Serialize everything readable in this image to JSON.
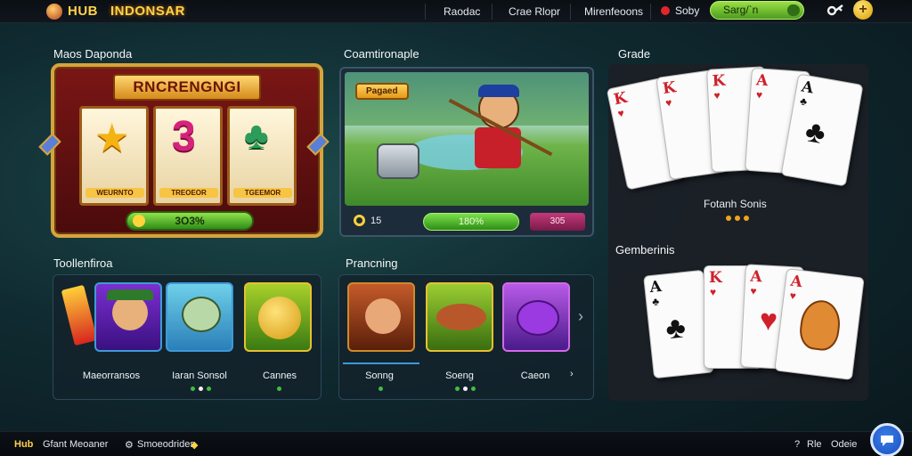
{
  "header": {
    "logo_hub": "HUB",
    "logo_name": "INDONSAR",
    "nav": [
      "Raodac",
      "Crae Rlopr",
      "Mirenfeoons"
    ],
    "ruby_label": "Soby",
    "pill_label": "Sarg/`n",
    "key_icon": "key-icon",
    "coin_icon": "coin-plus-icon",
    "coin_symbol": "+"
  },
  "slot_panel": {
    "title": "Maos Daponda",
    "banner": "RNCRENGNGI",
    "reels": [
      "WEURNTO",
      "TREOEOR",
      "TGEEMOR"
    ],
    "reel_symbols": [
      "★",
      "3",
      "♣"
    ],
    "button": "3O3%"
  },
  "adventure_panel": {
    "title": "Coamtironaple",
    "tag": "Pagaed",
    "left_value": "15",
    "bar_label": "180%",
    "right_label": "305"
  },
  "cards_panel_top": {
    "title": "Grade",
    "label": "Fotanh Sonis",
    "cards": [
      {
        "rank": "K",
        "suit": "♥",
        "color": "red"
      },
      {
        "rank": "K",
        "suit": "♥",
        "color": "red"
      },
      {
        "rank": "K",
        "suit": "♥",
        "color": "red"
      },
      {
        "rank": "A",
        "suit": "♥",
        "color": "red"
      },
      {
        "rank": "A",
        "suit": "♣",
        "color": "blk"
      }
    ]
  },
  "cards_panel_bottom": {
    "title": "Gemberinis",
    "cards": [
      {
        "rank": "A",
        "suit": "♣",
        "color": "blk"
      },
      {
        "rank": "K",
        "suit": "♥",
        "color": "red"
      },
      {
        "rank": "A",
        "suit": "♥",
        "color": "red"
      },
      {
        "rank": "A",
        "suit": "♥",
        "color": "red"
      }
    ]
  },
  "tournaments_panel": {
    "title": "Toollenfiroa",
    "tiles": [
      {
        "label": "Maeorransos",
        "colors": [
          "#7b2fd0",
          "#3a1080"
        ]
      },
      {
        "label": "Iaran Sonsol",
        "colors": [
          "#6fd0ea",
          "#2a7fb8"
        ]
      },
      {
        "label": "Cannes",
        "colors": [
          "#a8d02a",
          "#3a7a12"
        ]
      }
    ]
  },
  "trending_panel": {
    "title": "Prancning",
    "tiles": [
      {
        "label": "Sonng",
        "colors": [
          "#c45a2a",
          "#5a1f0a"
        ]
      },
      {
        "label": "Soeng",
        "colors": [
          "#9acd32",
          "#3a6e10"
        ]
      },
      {
        "label": "Caeon",
        "colors": [
          "#b85ae8",
          "#4a1a8a"
        ]
      }
    ]
  },
  "footer": {
    "left_brand": "Hub",
    "left_text": "Gfant Meoaner",
    "mid_text": "Smoeodrides",
    "right_a": "Rle",
    "right_b": "Odeie"
  }
}
